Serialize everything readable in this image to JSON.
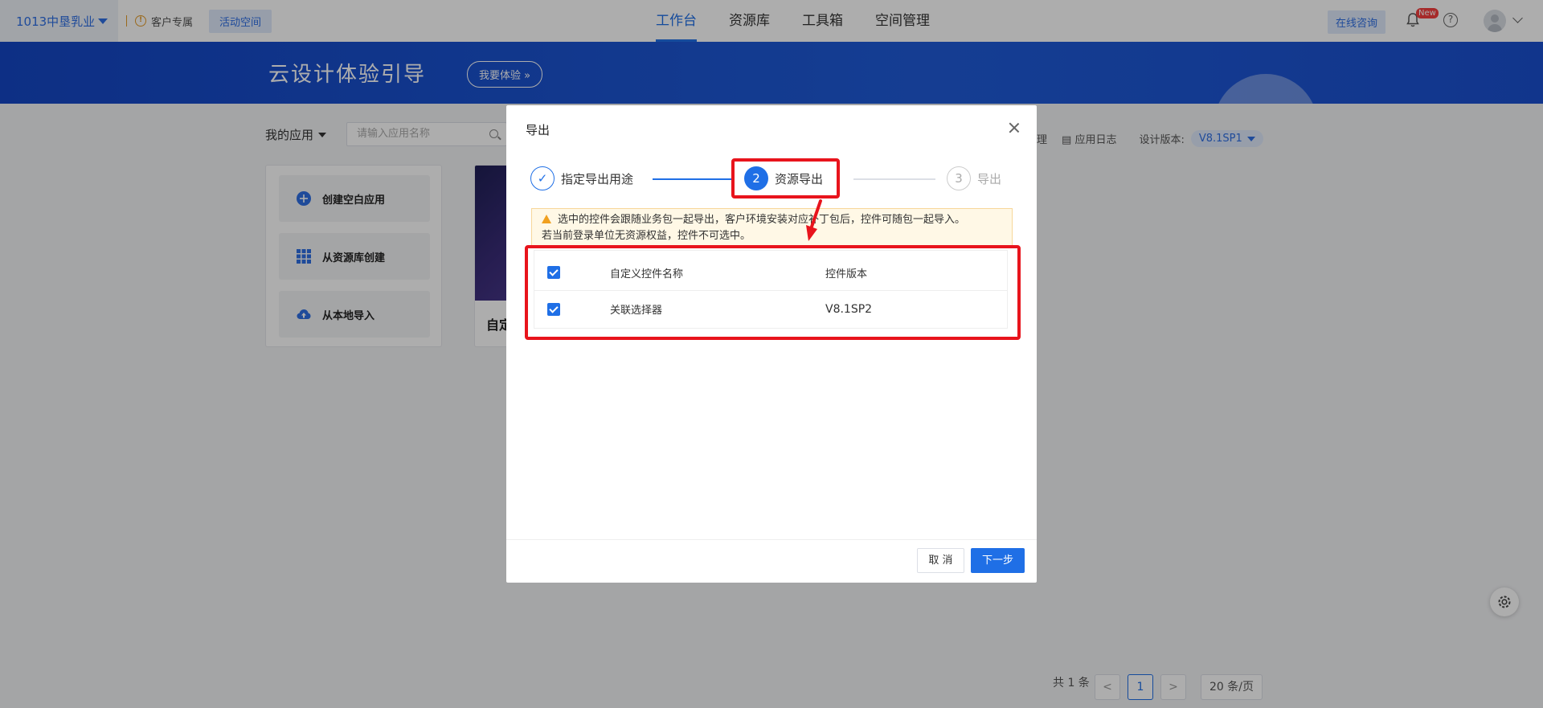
{
  "topnav": {
    "org_name": "1013中垦乳业",
    "customer_zone": "客户专属",
    "active_space": "活动空间",
    "tabs": [
      {
        "label": "工作台",
        "active": true
      },
      {
        "label": "资源库",
        "active": false
      },
      {
        "label": "工具箱",
        "active": false
      },
      {
        "label": "空间管理",
        "active": false
      }
    ],
    "consult_label": "在线咨询",
    "new_badge": "New",
    "help_glyph": "?"
  },
  "banner": {
    "title": "云设计体验引导",
    "button_label": "我要体验 »"
  },
  "toolbar": {
    "my_apps": "我的应用",
    "search_placeholder": "请输入应用名称",
    "fragment_text": "理",
    "app_log": "应用日志",
    "design_version_label": "设计版本:",
    "design_version_value": "V8.1SP1"
  },
  "create_panel": {
    "items": [
      {
        "label": "创建空白应用",
        "icon": "plus-circle-icon"
      },
      {
        "label": "从资源库创建",
        "icon": "grid-icon"
      },
      {
        "label": "从本地导入",
        "icon": "cloud-upload-icon"
      }
    ]
  },
  "app_card": {
    "name_fragment": "自定"
  },
  "pagination": {
    "total": "共 1 条",
    "prev": "<",
    "current_page": "1",
    "next": ">",
    "page_size": "20 条/页"
  },
  "modal": {
    "title": "导出",
    "steps": [
      {
        "number": "✓",
        "label": "指定导出用途",
        "state": "done"
      },
      {
        "number": "2",
        "label": "资源导出",
        "state": "active"
      },
      {
        "number": "3",
        "label": "导出",
        "state": "pending"
      }
    ],
    "warning_line1": "选中的控件会跟随业务包一起导出，客户环境安装对应补丁包后，控件可随包一起导入。",
    "warning_line2": "若当前登录单位无资源权益，控件不可选中。",
    "table": {
      "headers": [
        "自定义控件名称",
        "控件版本"
      ],
      "rows": [
        {
          "name": "关联选择器",
          "version": "V8.1SP2",
          "checked": true
        }
      ]
    },
    "cancel_label": "取 消",
    "next_label": "下一步"
  },
  "colors": {
    "primary": "#1f6fe6",
    "annotation": "#e8141c",
    "warning_bg": "#fff8e6"
  }
}
